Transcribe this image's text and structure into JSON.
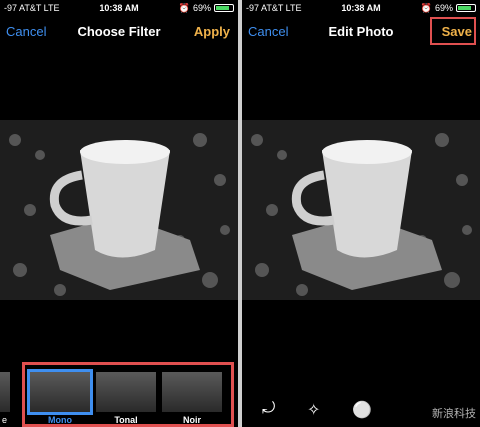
{
  "left": {
    "status": {
      "carrier": "-97 AT&T LTE",
      "time": "10:38 AM",
      "battery": "69%"
    },
    "nav": {
      "cancel": "Cancel",
      "title": "Choose Filter",
      "apply": "Apply"
    },
    "filters": {
      "partial": "e",
      "items": [
        "Mono",
        "Tonal",
        "Noir"
      ],
      "selected": "Mono"
    }
  },
  "right": {
    "status": {
      "carrier": "-97 AT&T LTE",
      "time": "10:38 AM",
      "battery": "69%"
    },
    "nav": {
      "cancel": "Cancel",
      "title": "Edit Photo",
      "save": "Save"
    },
    "toolbar": {
      "icons": [
        "rotate-icon",
        "magic-wand-icon",
        "filters-icon"
      ]
    },
    "watermark": "新浪科技"
  },
  "colors": {
    "accent_blue": "#3f8ff0",
    "accent_yellow": "#f0b24a",
    "highlight_red": "#e05050",
    "battery_green": "#4cd964"
  }
}
